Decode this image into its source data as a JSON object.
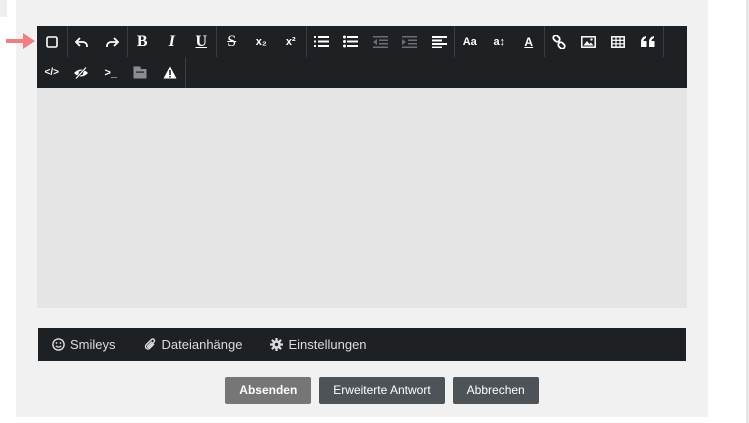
{
  "colors": {
    "toolbar_bg": "#1e2124",
    "editor_bg": "#e5e5e5",
    "panel_bg": "#f1f1f1",
    "arrow": "#f08080",
    "button_primary": "#767676",
    "button_secondary": "#4e5357"
  },
  "toolbar": {
    "row1": [
      {
        "name": "select-all-icon",
        "glyph": "checkbox"
      },
      {
        "name": "undo-icon",
        "glyph": "undo"
      },
      {
        "name": "redo-icon",
        "glyph": "redo"
      },
      {
        "name": "bold-icon",
        "label": "B"
      },
      {
        "name": "italic-icon",
        "label": "I"
      },
      {
        "name": "underline-icon",
        "label": "U"
      },
      {
        "name": "strikethrough-icon",
        "label": "S"
      },
      {
        "name": "subscript-icon",
        "label": "x₂"
      },
      {
        "name": "superscript-icon",
        "label": "x²"
      },
      {
        "name": "ordered-list-icon",
        "glyph": "ol"
      },
      {
        "name": "unordered-list-icon",
        "glyph": "ul"
      },
      {
        "name": "outdent-icon",
        "glyph": "outdent",
        "disabled": true
      },
      {
        "name": "indent-icon",
        "glyph": "indent",
        "disabled": true
      },
      {
        "name": "align-icon",
        "glyph": "align"
      },
      {
        "name": "font-size-icon",
        "label": "Aa"
      },
      {
        "name": "line-height-icon",
        "label": "a↕"
      },
      {
        "name": "text-color-icon",
        "label": "A"
      },
      {
        "name": "link-icon",
        "glyph": "link"
      },
      {
        "name": "image-icon",
        "glyph": "image"
      },
      {
        "name": "table-icon",
        "glyph": "table"
      },
      {
        "name": "quote-icon",
        "glyph": "quote"
      }
    ],
    "row2": [
      {
        "name": "source-code-icon",
        "label": "</>"
      },
      {
        "name": "spoiler-icon",
        "glyph": "eye-slash"
      },
      {
        "name": "inline-code-icon",
        "label": ">_"
      },
      {
        "name": "media-icon",
        "glyph": "media"
      },
      {
        "name": "warning-icon",
        "glyph": "warning"
      }
    ]
  },
  "tabs": [
    {
      "label": "Smileys",
      "icon": "smiley-icon"
    },
    {
      "label": "Dateianhänge",
      "icon": "paperclip-icon"
    },
    {
      "label": "Einstellungen",
      "icon": "gear-icon"
    }
  ],
  "actions": {
    "submit_label": "Absenden",
    "extended_label": "Erweiterte Antwort",
    "cancel_label": "Abbrechen"
  }
}
